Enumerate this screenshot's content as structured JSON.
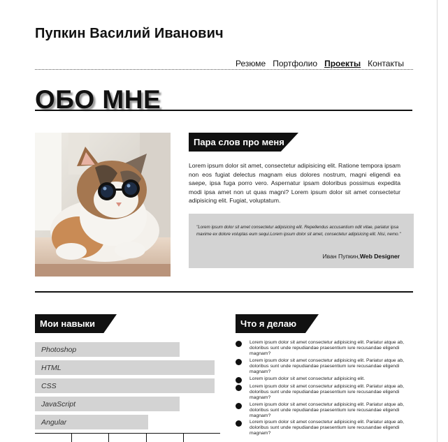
{
  "header": {
    "site_name": "Пупкин Василий Иванович",
    "nav": [
      {
        "label": "Резюме",
        "active": false
      },
      {
        "label": "Портфолио",
        "active": false
      },
      {
        "label": "Проекты",
        "active": true
      },
      {
        "label": "Контакты",
        "active": false
      }
    ]
  },
  "about": {
    "title": "ОБО МНЕ",
    "photo_icon": "cat-with-sunglasses-photo",
    "tag_label": "Пара слов про меня",
    "text": "Lorem ipsum dolor sit amet, consectetur adipisicing elit. Ratione tempora ipsam non eos fugiat delectus magnam eius dolores nostrum, magni eligendi ea saepe, ipsa fuga porro vero. Aspernatur ipsam doloribus possimus expedita modi ipsa amet non ut quas magni? Lorem ipsum dolor sit amet consectetur adipisicing elit. Fugiat, voluptatum.",
    "quote": {
      "text": "\"Lorem ipsum dolor sit amet consectetur adipisicing elit. Repellendus accusantium odit vitae, pariatur ipsa maxime ex dolore voluptas eum sequi.Lorem ipsum dolor sit amet, consectetur adipisicing elit. Nisi, nemo.\"",
      "author_name": "Иван Пупкин,",
      "author_role": "Web Designer"
    }
  },
  "skills": {
    "title": "Мои навыки",
    "items": [
      {
        "label": "Photoshop",
        "level": 0.78
      },
      {
        "label": "HTML",
        "level": 0.97
      },
      {
        "label": "CSS",
        "level": 0.97
      },
      {
        "label": "JavaScript",
        "level": 0.78
      },
      {
        "label": "Angular",
        "level": 0.61
      }
    ]
  },
  "what_i_do": {
    "title": "Что я делаю",
    "items": [
      "Lorem ipsum dolor sit amet consectetur adipisicing elit. Pariatur atque ab, doloribus sunt unde repudiandae praesentium iure recusandae eligendi magnam?",
      "Lorem ipsum dolor sit amet consectetur adipisicing elit. Pariatur atque ab, doloribus sunt unde repudiandae praesentium iure recusandae eligendi magnam?",
      "Lorem ipsum dolor sit amet consectetur adipisicing elit.",
      "Lorem ipsum dolor sit amet consectetur adipisicing elit. Pariatur atque ab, doloribus sunt unde repudiandae praesentium iure recusandae eligendi magnam?",
      "Lorem ipsum dolor sit amet consectetur adipisicing elit. Pariatur atque ab, doloribus sunt unde repudiandae praesentium iure recusandae eligendi magnam?",
      "Lorem ipsum dolor sit amet consectetur adipisicing elit. Pariatur atque ab, doloribus sunt unde repudiandae praesentium iure recusandae eligendi magnam?"
    ]
  }
}
